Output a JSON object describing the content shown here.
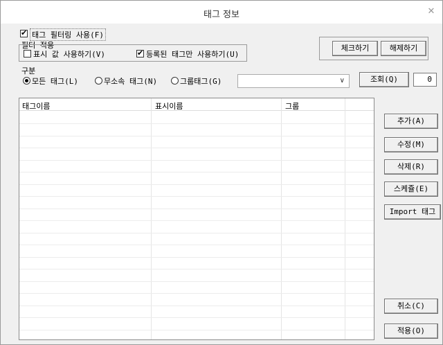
{
  "window": {
    "title": "태그 정보",
    "close_icon": "close-icon"
  },
  "filter": {
    "use_filter_label": "태그 필터링 사용(F)",
    "use_filter_checked": true,
    "section_label": "필터 적용",
    "display_value_label": "표시 값 사용하기(V)",
    "display_value_checked": false,
    "registered_only_label": "등록된 태그만 사용하기(U)",
    "registered_only_checked": true
  },
  "check_buttons": {
    "check_label": "체크하기",
    "uncheck_label": "해제하기"
  },
  "category": {
    "label": "구분",
    "options": [
      "모든 태그(L)",
      "무소속 태그(N)",
      "그룹태그(G)"
    ],
    "selected": "모든 태그(L)",
    "combo_value": ""
  },
  "query": {
    "button_label": "조회(Q)",
    "count": "0"
  },
  "table": {
    "columns": [
      "태그이름",
      "표시이름",
      "그룹"
    ]
  },
  "side_buttons": {
    "add": "추가(A)",
    "edit": "수정(M)",
    "delete": "삭제(R)",
    "schedule": "스케쥴(E)",
    "import": "Import 태그",
    "cancel": "취소(C)",
    "apply": "적용(O)"
  }
}
